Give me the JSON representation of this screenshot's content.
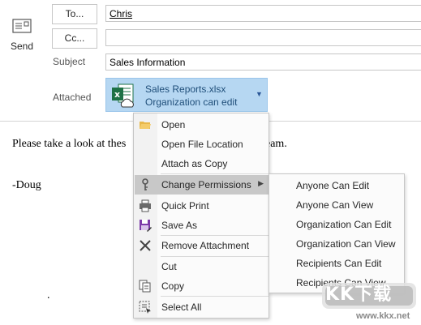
{
  "compose": {
    "send_label": "Send",
    "to_button": "To...",
    "cc_button": "Cc...",
    "subject_label": "Subject",
    "attached_label": "Attached",
    "to_value": "Chris",
    "cc_value": "",
    "subject_value": "Sales Information"
  },
  "attachment": {
    "file_name": "Sales Reports.xlsx",
    "permission": "Organization can edit",
    "icon": "excel-cloud-icon"
  },
  "body": {
    "line1_start": "Please take a look at thes",
    "line1_end": "eam.",
    "line2": "-Doug",
    "line3": "."
  },
  "context_menu": {
    "items": [
      {
        "label": "Open",
        "icon": "folder-open-icon"
      },
      {
        "label": "Open File Location",
        "icon": ""
      },
      {
        "label": "Attach as Copy",
        "icon": ""
      },
      {
        "label": "Change Permissions",
        "icon": "key-icon",
        "highlighted": true,
        "has_submenu": true
      },
      {
        "label": "Quick Print",
        "icon": "printer-icon"
      },
      {
        "label": "Save As",
        "icon": "save-as-icon"
      },
      {
        "label": "Remove Attachment",
        "icon": "x-icon"
      },
      {
        "label": "Cut",
        "icon": ""
      },
      {
        "label": "Copy",
        "icon": "copy-icon"
      },
      {
        "label": "Select All",
        "icon": "select-all-icon"
      }
    ]
  },
  "permissions_submenu": {
    "items": [
      "Anyone Can Edit",
      "Anyone Can View",
      "Organization Can Edit",
      "Organization Can View",
      "Recipients Can Edit",
      "Recipients Can View"
    ]
  },
  "watermark": {
    "badge": "KK下载",
    "url": "www.kkx.net"
  },
  "colors": {
    "attachment_bg": "#b6d7f2",
    "menu_highlight": "#c8c8c8",
    "excel_green": "#1e7145",
    "menu_bg": "#fbfbfb"
  }
}
